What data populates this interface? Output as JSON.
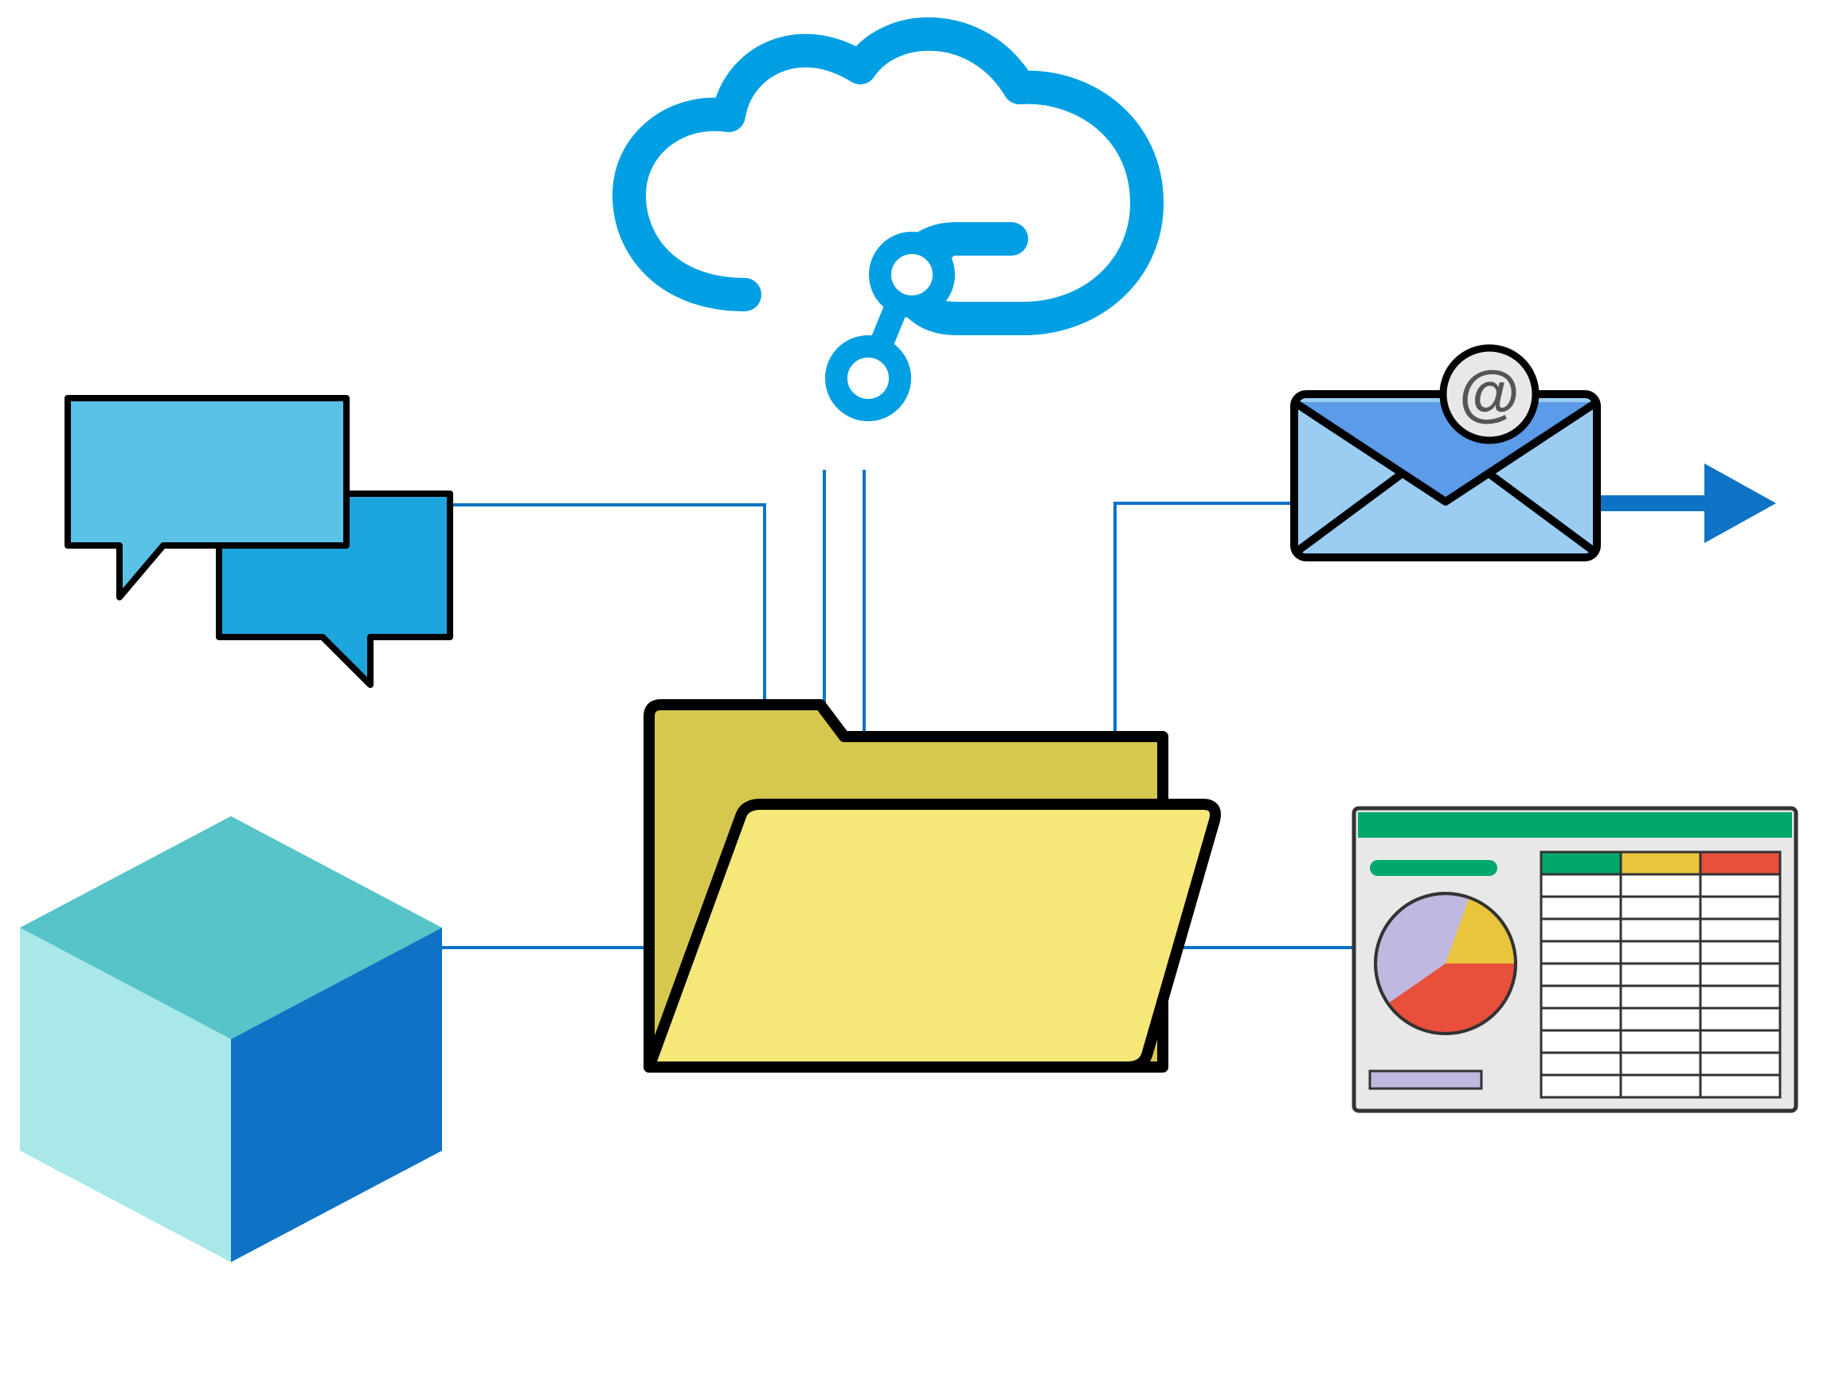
{
  "diagram": {
    "type": "cloud-data-architecture",
    "nodes": {
      "cloud": {
        "name": "cloud-service",
        "type": "cloud-computing"
      },
      "chat": {
        "name": "messaging",
        "type": "communication"
      },
      "email": {
        "name": "email",
        "type": "communication"
      },
      "folder": {
        "name": "file-storage",
        "type": "storage"
      },
      "cube": {
        "name": "data-block",
        "type": "storage"
      },
      "spreadsheet": {
        "name": "analytics-dashboard",
        "type": "analytics"
      }
    },
    "connections": [
      {
        "from": "chat",
        "to": "folder"
      },
      {
        "from": "cloud",
        "to": "folder"
      },
      {
        "from": "email",
        "to": "folder"
      },
      {
        "from": "cube",
        "to": "folder"
      },
      {
        "from": "folder",
        "to": "spreadsheet"
      },
      {
        "from": "email",
        "to": "arrow-out"
      }
    ],
    "colors": {
      "cloud_stroke": "#009fe3",
      "chat_light": "#5bc2e7",
      "chat_dark": "#1da5de",
      "email_light": "#9bcdf2",
      "email_dark": "#0e72c5",
      "folder_back": "#d6c84f",
      "folder_front": "#f5e878",
      "cube_top": "#7fd9d9",
      "cube_left": "#a8e8e8",
      "cube_right": "#0e72c5",
      "connector": "#0e72c5",
      "spreadsheet_green": "#00a86b",
      "spreadsheet_red": "#e8503c",
      "spreadsheet_yellow": "#e8c53c",
      "spreadsheet_purple": "#c0b8e0"
    }
  }
}
